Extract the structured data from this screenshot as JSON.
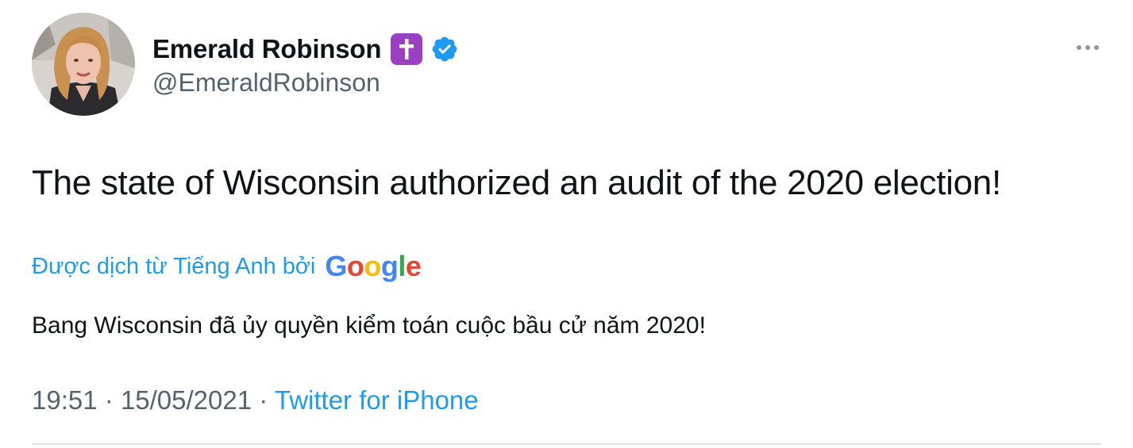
{
  "author": {
    "display_name": "Emerald Robinson",
    "handle": "@EmeraldRobinson",
    "name_emoji": "latin-cross-emoji",
    "verified": true
  },
  "tweet": {
    "text": "The state of Wisconsin authorized an audit of the 2020 election!",
    "translated_by_label": "Được dịch từ Tiếng Anh bởi",
    "translation_provider": {
      "letters": [
        "G",
        "o",
        "o",
        "g",
        "l",
        "e"
      ]
    },
    "translated_text": "Bang Wisconsin đã ủy quyền kiểm toán cuộc bầu cử năm 2020!",
    "time": "19:51",
    "date": "15/05/2021",
    "separator": "·",
    "source": "Twitter for iPhone"
  },
  "icons": {
    "more": "more-horizontal-icon",
    "verified": "verified-badge-icon"
  },
  "colors": {
    "link_blue": "#1d9bf0",
    "secondary_text": "#536471",
    "primary_text": "#0f1419",
    "emoji_purple": "#9b3fc4",
    "google_blue": "#4285f4",
    "google_red": "#ea4335",
    "google_yellow": "#fbbc05",
    "google_green": "#34a853"
  }
}
